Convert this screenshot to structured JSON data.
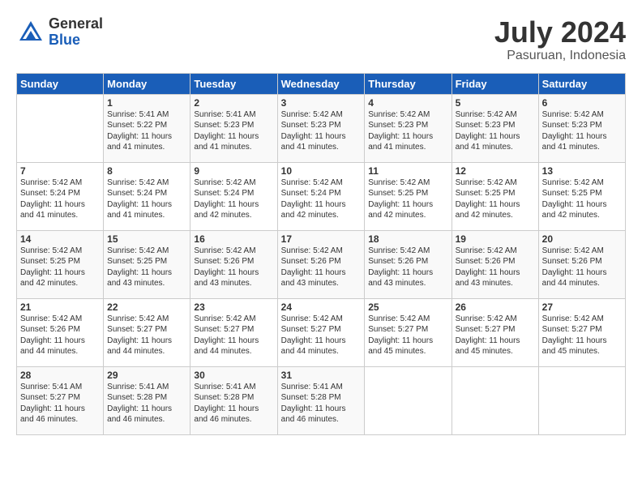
{
  "logo": {
    "general": "General",
    "blue": "Blue"
  },
  "title": "July 2024",
  "location": "Pasuruan, Indonesia",
  "days_of_week": [
    "Sunday",
    "Monday",
    "Tuesday",
    "Wednesday",
    "Thursday",
    "Friday",
    "Saturday"
  ],
  "weeks": [
    [
      {
        "day": "",
        "info": ""
      },
      {
        "day": "1",
        "info": "Sunrise: 5:41 AM\nSunset: 5:22 PM\nDaylight: 11 hours\nand 41 minutes."
      },
      {
        "day": "2",
        "info": "Sunrise: 5:41 AM\nSunset: 5:23 PM\nDaylight: 11 hours\nand 41 minutes."
      },
      {
        "day": "3",
        "info": "Sunrise: 5:42 AM\nSunset: 5:23 PM\nDaylight: 11 hours\nand 41 minutes."
      },
      {
        "day": "4",
        "info": "Sunrise: 5:42 AM\nSunset: 5:23 PM\nDaylight: 11 hours\nand 41 minutes."
      },
      {
        "day": "5",
        "info": "Sunrise: 5:42 AM\nSunset: 5:23 PM\nDaylight: 11 hours\nand 41 minutes."
      },
      {
        "day": "6",
        "info": "Sunrise: 5:42 AM\nSunset: 5:23 PM\nDaylight: 11 hours\nand 41 minutes."
      }
    ],
    [
      {
        "day": "7",
        "info": "Sunrise: 5:42 AM\nSunset: 5:24 PM\nDaylight: 11 hours\nand 41 minutes."
      },
      {
        "day": "8",
        "info": "Sunrise: 5:42 AM\nSunset: 5:24 PM\nDaylight: 11 hours\nand 41 minutes."
      },
      {
        "day": "9",
        "info": "Sunrise: 5:42 AM\nSunset: 5:24 PM\nDaylight: 11 hours\nand 42 minutes."
      },
      {
        "day": "10",
        "info": "Sunrise: 5:42 AM\nSunset: 5:24 PM\nDaylight: 11 hours\nand 42 minutes."
      },
      {
        "day": "11",
        "info": "Sunrise: 5:42 AM\nSunset: 5:25 PM\nDaylight: 11 hours\nand 42 minutes."
      },
      {
        "day": "12",
        "info": "Sunrise: 5:42 AM\nSunset: 5:25 PM\nDaylight: 11 hours\nand 42 minutes."
      },
      {
        "day": "13",
        "info": "Sunrise: 5:42 AM\nSunset: 5:25 PM\nDaylight: 11 hours\nand 42 minutes."
      }
    ],
    [
      {
        "day": "14",
        "info": "Sunrise: 5:42 AM\nSunset: 5:25 PM\nDaylight: 11 hours\nand 42 minutes."
      },
      {
        "day": "15",
        "info": "Sunrise: 5:42 AM\nSunset: 5:25 PM\nDaylight: 11 hours\nand 43 minutes."
      },
      {
        "day": "16",
        "info": "Sunrise: 5:42 AM\nSunset: 5:26 PM\nDaylight: 11 hours\nand 43 minutes."
      },
      {
        "day": "17",
        "info": "Sunrise: 5:42 AM\nSunset: 5:26 PM\nDaylight: 11 hours\nand 43 minutes."
      },
      {
        "day": "18",
        "info": "Sunrise: 5:42 AM\nSunset: 5:26 PM\nDaylight: 11 hours\nand 43 minutes."
      },
      {
        "day": "19",
        "info": "Sunrise: 5:42 AM\nSunset: 5:26 PM\nDaylight: 11 hours\nand 43 minutes."
      },
      {
        "day": "20",
        "info": "Sunrise: 5:42 AM\nSunset: 5:26 PM\nDaylight: 11 hours\nand 44 minutes."
      }
    ],
    [
      {
        "day": "21",
        "info": "Sunrise: 5:42 AM\nSunset: 5:26 PM\nDaylight: 11 hours\nand 44 minutes."
      },
      {
        "day": "22",
        "info": "Sunrise: 5:42 AM\nSunset: 5:27 PM\nDaylight: 11 hours\nand 44 minutes."
      },
      {
        "day": "23",
        "info": "Sunrise: 5:42 AM\nSunset: 5:27 PM\nDaylight: 11 hours\nand 44 minutes."
      },
      {
        "day": "24",
        "info": "Sunrise: 5:42 AM\nSunset: 5:27 PM\nDaylight: 11 hours\nand 44 minutes."
      },
      {
        "day": "25",
        "info": "Sunrise: 5:42 AM\nSunset: 5:27 PM\nDaylight: 11 hours\nand 45 minutes."
      },
      {
        "day": "26",
        "info": "Sunrise: 5:42 AM\nSunset: 5:27 PM\nDaylight: 11 hours\nand 45 minutes."
      },
      {
        "day": "27",
        "info": "Sunrise: 5:42 AM\nSunset: 5:27 PM\nDaylight: 11 hours\nand 45 minutes."
      }
    ],
    [
      {
        "day": "28",
        "info": "Sunrise: 5:41 AM\nSunset: 5:27 PM\nDaylight: 11 hours\nand 46 minutes."
      },
      {
        "day": "29",
        "info": "Sunrise: 5:41 AM\nSunset: 5:28 PM\nDaylight: 11 hours\nand 46 minutes."
      },
      {
        "day": "30",
        "info": "Sunrise: 5:41 AM\nSunset: 5:28 PM\nDaylight: 11 hours\nand 46 minutes."
      },
      {
        "day": "31",
        "info": "Sunrise: 5:41 AM\nSunset: 5:28 PM\nDaylight: 11 hours\nand 46 minutes."
      },
      {
        "day": "",
        "info": ""
      },
      {
        "day": "",
        "info": ""
      },
      {
        "day": "",
        "info": ""
      }
    ]
  ]
}
